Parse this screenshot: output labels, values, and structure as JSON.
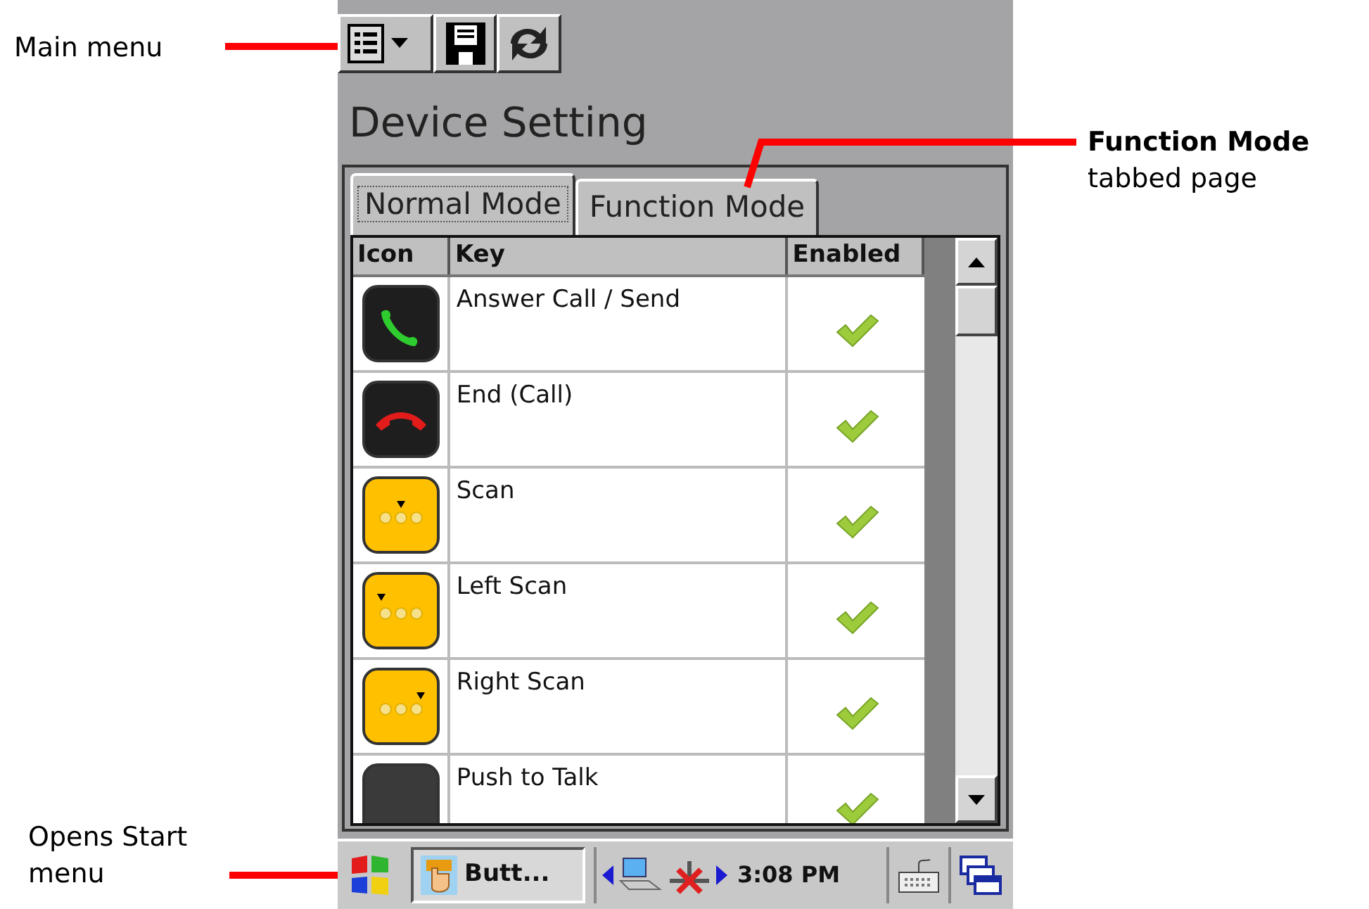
{
  "annotations": {
    "main_menu": "Main menu",
    "start_menu": "Opens Start menu",
    "function_mode": {
      "title": "Function Mode",
      "text": "tabbed page"
    }
  },
  "toolbar": [
    {
      "kind": "menu"
    },
    {
      "kind": "save"
    },
    {
      "kind": "refresh"
    }
  ],
  "title": "Device Setting",
  "tabs": [
    {
      "label": "Normal Mode",
      "selected": true
    },
    {
      "label": "Function Mode",
      "selected": false
    }
  ],
  "table": {
    "columns": [
      "Icon",
      "Key",
      "Enabled"
    ],
    "rows": [
      {
        "kind": "call",
        "key": "Answer Call / Send",
        "enabled": true
      },
      {
        "kind": "end",
        "key": "End (Call)",
        "enabled": true
      },
      {
        "kind": "scan",
        "key": "Scan",
        "enabled": true
      },
      {
        "kind": "scan_left",
        "key": "Left Scan",
        "enabled": true
      },
      {
        "kind": "scan_right",
        "key": "Right Scan",
        "enabled": true
      },
      {
        "kind": "app",
        "key": "Push to Talk",
        "enabled": true
      }
    ]
  },
  "taskbar": {
    "app_button": "Butt...",
    "time": "3:08 PM"
  }
}
